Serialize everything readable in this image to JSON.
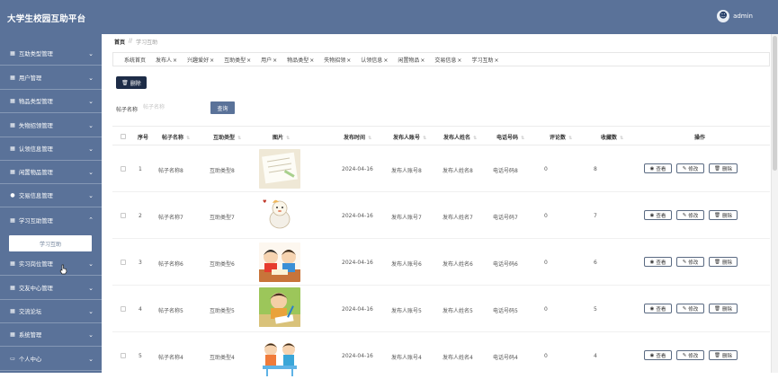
{
  "header": {
    "app_title": "大学生校园互助平台",
    "username": "admin"
  },
  "sidebar": {
    "items": [
      {
        "label": "互助类型管理",
        "icon": "grid-icon",
        "expanded": false
      },
      {
        "label": "用户管理",
        "icon": "grid-icon",
        "expanded": false
      },
      {
        "label": "物品类型管理",
        "icon": "grid-icon",
        "expanded": false
      },
      {
        "label": "失物招领管理",
        "icon": "grid-icon",
        "expanded": false
      },
      {
        "label": "认领信息管理",
        "icon": "grid-icon",
        "expanded": false
      },
      {
        "label": "闲置物品管理",
        "icon": "grid-icon",
        "expanded": false
      },
      {
        "label": "交易信息管理",
        "icon": "person-icon",
        "expanded": false
      },
      {
        "label": "学习互助管理",
        "icon": "grid-icon",
        "expanded": true
      },
      {
        "label": "实习岗位管理",
        "icon": "grid-icon",
        "expanded": false
      },
      {
        "label": "交友中心管理",
        "icon": "grid-icon",
        "expanded": false
      },
      {
        "label": "交流论坛",
        "icon": "grid-icon",
        "expanded": false
      },
      {
        "label": "系统管理",
        "icon": "grid-icon",
        "expanded": false
      },
      {
        "label": "个人中心",
        "icon": "monitor-icon",
        "expanded": false
      }
    ],
    "active_sub": "学习互助"
  },
  "breadcrumb": {
    "home": "首页",
    "separator": "//",
    "current": "学习互助"
  },
  "tabs": [
    {
      "label": "系统首页",
      "closable": false
    },
    {
      "label": "发布人",
      "closable": true
    },
    {
      "label": "兴趣爱好",
      "closable": true
    },
    {
      "label": "互助类型",
      "closable": true
    },
    {
      "label": "用户",
      "closable": true
    },
    {
      "label": "物品类型",
      "closable": true
    },
    {
      "label": "失物招领",
      "closable": true
    },
    {
      "label": "认领信息",
      "closable": true
    },
    {
      "label": "闲置物品",
      "closable": true
    },
    {
      "label": "交易信息",
      "closable": true
    },
    {
      "label": "学习互助",
      "closable": true
    }
  ],
  "toolbar": {
    "delete_label": "删除"
  },
  "search": {
    "label": "帖子名称",
    "placeholder": "帖子名称",
    "button_label": "查询"
  },
  "table": {
    "columns": [
      "序号",
      "帖子名称",
      "互助类型",
      "图片",
      "发布时间",
      "发布人账号",
      "发布人姓名",
      "电话号码",
      "评论数",
      "收藏数",
      "操作"
    ],
    "rows": [
      {
        "index": "1",
        "title": "帖子名称8",
        "type": "互助类型8",
        "date": "2024-04-16",
        "account": "发布人账号8",
        "name": "发布人姓名8",
        "phone": "电话号码8",
        "comments": "0",
        "favorites": "8"
      },
      {
        "index": "2",
        "title": "帖子名称7",
        "type": "互助类型7",
        "date": "2024-04-16",
        "account": "发布人账号7",
        "name": "发布人姓名7",
        "phone": "电话号码7",
        "comments": "0",
        "favorites": "7"
      },
      {
        "index": "3",
        "title": "帖子名称6",
        "type": "互助类型6",
        "date": "2024-04-16",
        "account": "发布人账号6",
        "name": "发布人姓名6",
        "phone": "电话号码6",
        "comments": "0",
        "favorites": "6"
      },
      {
        "index": "4",
        "title": "帖子名称5",
        "type": "互助类型5",
        "date": "2024-04-16",
        "account": "发布人账号5",
        "name": "发布人姓名5",
        "phone": "电话号码5",
        "comments": "0",
        "favorites": "5"
      },
      {
        "index": "5",
        "title": "帖子名称4",
        "type": "互助类型4",
        "date": "2024-04-16",
        "account": "发布人账号4",
        "name": "发布人姓名4",
        "phone": "电话号码4",
        "comments": "0",
        "favorites": "4"
      }
    ],
    "actions": {
      "view": "查看",
      "edit": "修改",
      "delete": "删除"
    }
  },
  "colors": {
    "primary": "#5a7299",
    "dark_button": "#1d2c47"
  }
}
